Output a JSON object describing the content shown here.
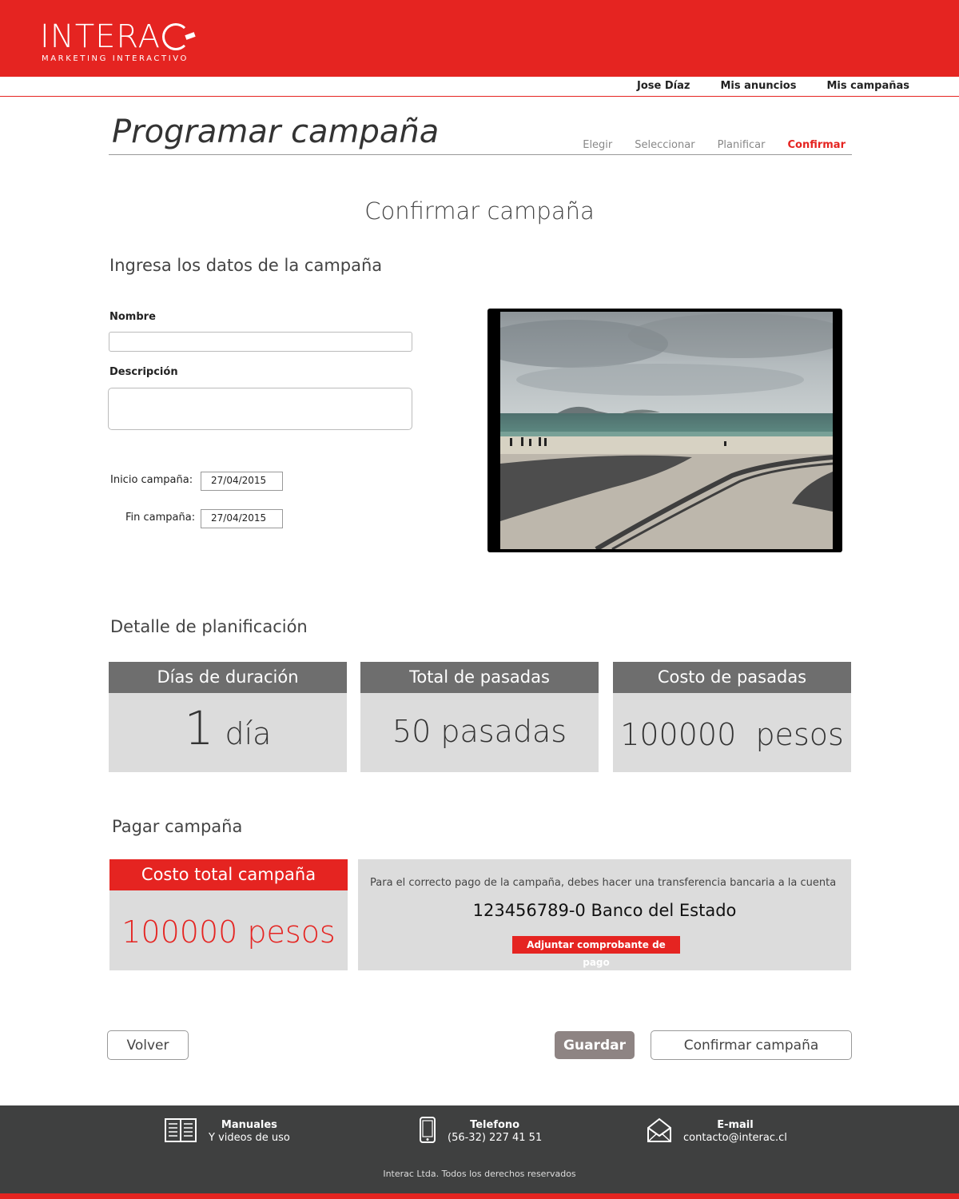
{
  "header": {
    "logo_main": "INTERA",
    "logo_sub": "MARKETING INTERACTIVO",
    "nav": {
      "user": "Jose Díaz",
      "ads": "Mis anuncios",
      "campaigns": "Mis campañas"
    }
  },
  "page": {
    "title": "Programar campaña",
    "steps": [
      "Elegir",
      "Seleccionar",
      "Planificar",
      "Confirmar"
    ],
    "active_step": "Confirmar",
    "section_title": "Confirmar campaña"
  },
  "form": {
    "heading": "Ingresa los datos de la campaña",
    "name_label": "Nombre",
    "name_value": "",
    "description_label": "Descripción",
    "description_value": "",
    "start_label": "Inicio campaña:",
    "start_value": "27/04/2015",
    "end_label": "Fin campaña:",
    "end_value": "27/04/2015"
  },
  "planning": {
    "heading": "Detalle de planificación",
    "cards": [
      {
        "title": "Días de duración",
        "number": "1",
        "unit": "día"
      },
      {
        "title": "Total de pasadas",
        "number": "50",
        "unit": "pasadas"
      },
      {
        "title": "Costo de pasadas",
        "number": "100000",
        "unit": "pesos"
      }
    ]
  },
  "payment": {
    "heading": "Pagar campaña",
    "total_title": "Costo total campaña",
    "total_value": "100000  pesos",
    "note": "Para el correcto pago de la campaña, debes hacer una transferencia bancaria a la cuenta",
    "account": "123456789-0  Banco del Estado",
    "attach_label": "Adjuntar comprobante de pago"
  },
  "actions": {
    "back": "Volver",
    "save": "Guardar",
    "confirm": "Confirmar campaña"
  },
  "footer": {
    "manuals_title": "Manuales",
    "manuals_sub": "Y videos de uso",
    "phone_title": "Telefono",
    "phone_value": "(56-32) 227 41 51",
    "email_title": "E-mail",
    "email_value": "contacto@interac.cl",
    "copyright": "Interac Ltda. Todos los derechos reservados"
  },
  "colors": {
    "brand_red": "#e52421",
    "card_grey": "#dcdcdc",
    "card_header_grey": "#6e6e6e",
    "footer_dark": "#3f4040"
  }
}
